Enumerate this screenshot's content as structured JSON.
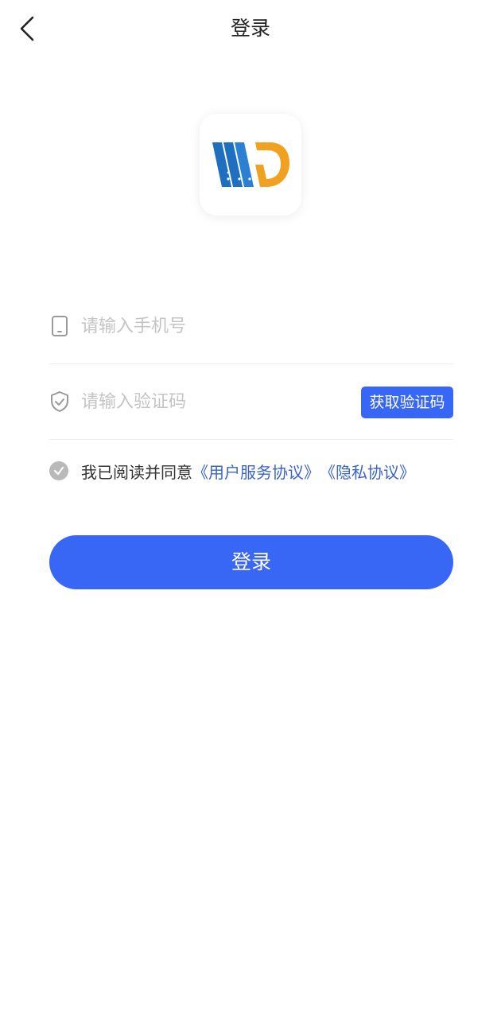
{
  "header": {
    "title": "登录",
    "back_icon": "chevron-left-icon"
  },
  "logo": {
    "icon": "app-logo-wp",
    "colors": {
      "blue": "#1f6fc0",
      "orange": "#f0a11f"
    }
  },
  "phone_field": {
    "icon": "phone-icon",
    "placeholder": "请输入手机号",
    "value": ""
  },
  "code_field": {
    "icon": "shield-check-icon",
    "placeholder": "请输入验证码",
    "value": "",
    "get_code_label": "获取验证码"
  },
  "agreement": {
    "checked": true,
    "text": "我已阅读并同意",
    "user_agreement": "《用户服务协议》",
    "privacy_policy": "《隐私协议》"
  },
  "login_button": {
    "label": "登录"
  },
  "colors": {
    "primary": "#3967f5",
    "link": "#3a63c8",
    "placeholder": "#c4c4c4"
  }
}
